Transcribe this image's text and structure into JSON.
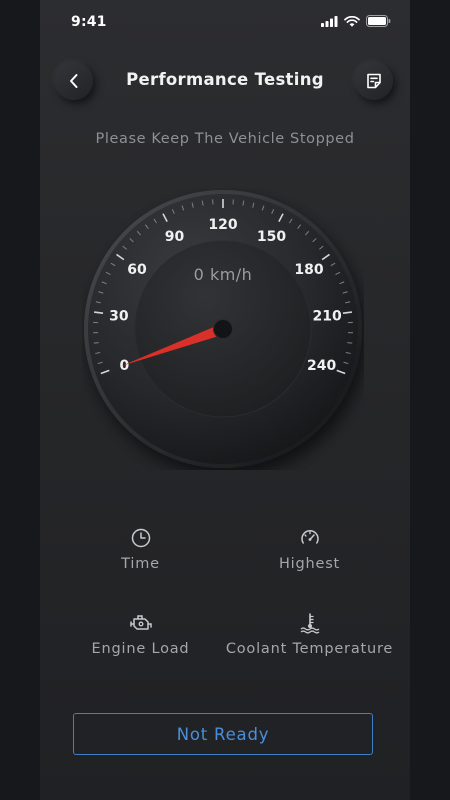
{
  "status_bar": {
    "time": "9:41"
  },
  "header": {
    "title": "Performance Testing"
  },
  "subtitle": "Please Keep The Vehicle Stopped",
  "speedometer": {
    "speed_label": "0 km/h",
    "current_speed": 0,
    "max_speed": 240,
    "tick_labels": [
      "0",
      "30",
      "60",
      "90",
      "120",
      "150",
      "180",
      "210",
      "240"
    ],
    "needle_color": "#d9302a"
  },
  "metrics": {
    "time_label": "Time",
    "highest_label": "Highest",
    "engine_load_label": "Engine Load",
    "coolant_label": "Coolant Temperature"
  },
  "status_button": {
    "label": "Not Ready",
    "color": "#4a8fd9"
  },
  "icons": {
    "back": "back-chevron-icon",
    "report": "report-icon",
    "time": "clock-icon",
    "highest": "speedometer-icon",
    "engine_load": "engine-icon",
    "coolant": "coolant-temperature-icon"
  }
}
